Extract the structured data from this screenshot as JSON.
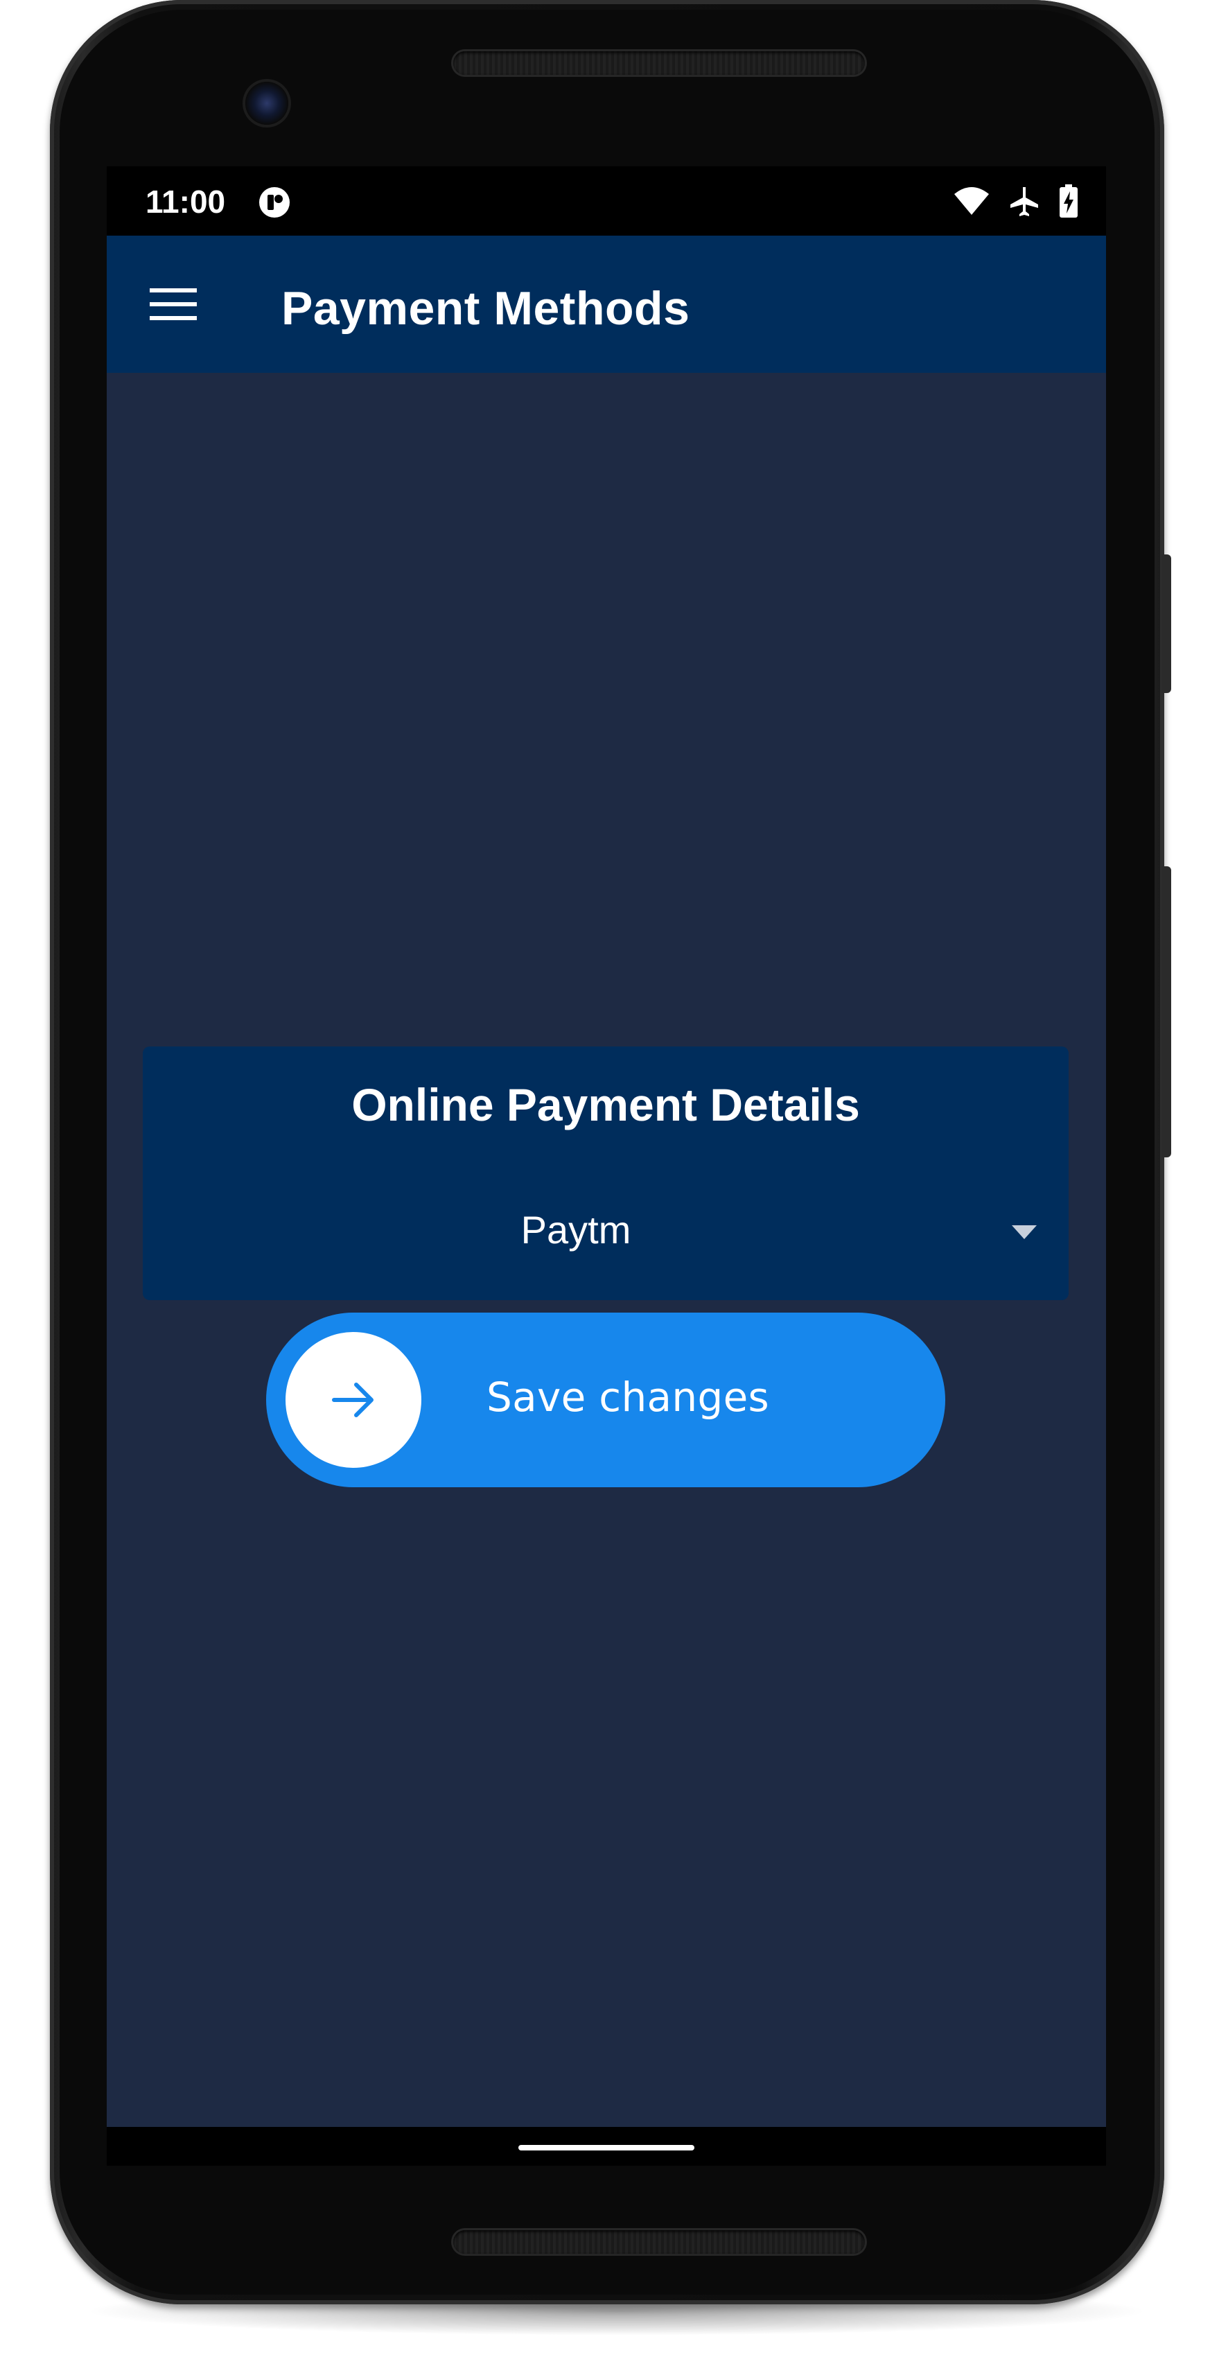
{
  "status_bar": {
    "time": "11:00",
    "icons": [
      "notification-app-icon",
      "wifi-icon",
      "airplane-mode-icon",
      "battery-charging-icon"
    ]
  },
  "app_bar": {
    "menu_icon": "hamburger-menu-icon",
    "title": "Payment Methods"
  },
  "payment_card": {
    "title": "Online Payment Details",
    "selected_method": "Paytm",
    "dropdown_icon": "dropdown-arrow-icon"
  },
  "save_button": {
    "label": "Save changes",
    "icon": "arrow-right-icon"
  },
  "colors": {
    "screen_background": "#1e2a44",
    "app_bar": "#002d5c",
    "card": "#002d5c",
    "accent": "#1787ec"
  }
}
